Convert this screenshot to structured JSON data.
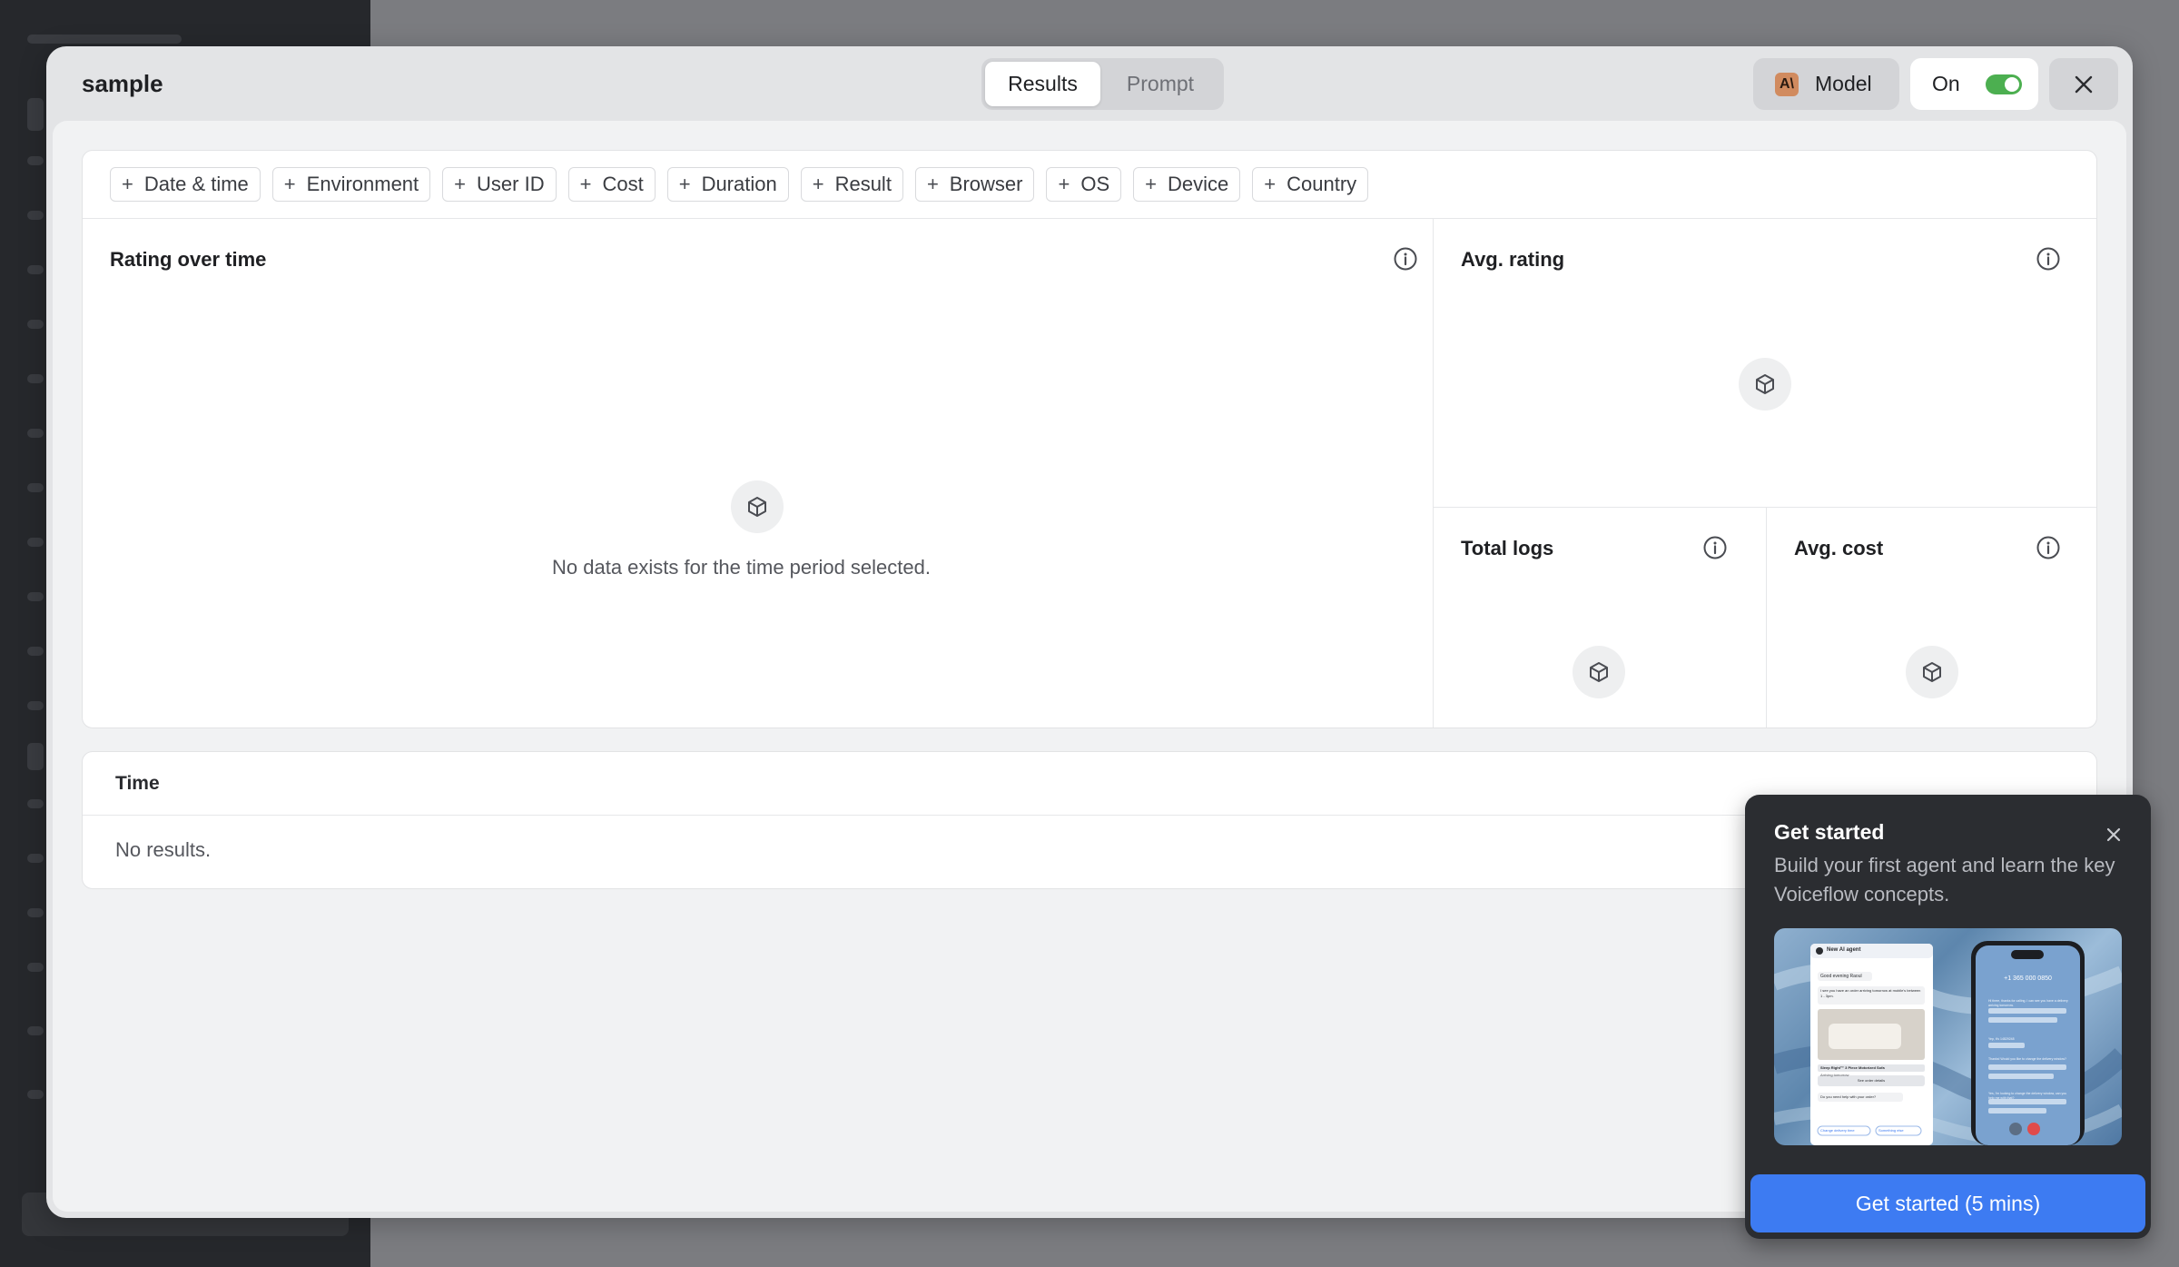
{
  "header": {
    "title": "sample",
    "tabs": [
      {
        "label": "Results",
        "active": true
      },
      {
        "label": "Prompt",
        "active": false
      }
    ],
    "model_label": "Model",
    "model_badge": "A\\",
    "on_label": "On",
    "toggle_on": true
  },
  "filters": [
    "Date & time",
    "Environment",
    "User ID",
    "Cost",
    "Duration",
    "Result",
    "Browser",
    "OS",
    "Device",
    "Country"
  ],
  "filter_plus": "+",
  "panels": {
    "rating_over_time": {
      "title": "Rating over time",
      "empty_text": "No data exists for the time period selected."
    },
    "avg_rating": {
      "title": "Avg. rating"
    },
    "total_logs": {
      "title": "Total logs"
    },
    "avg_cost": {
      "title": "Avg. cost"
    }
  },
  "table": {
    "column_header": "Time",
    "empty_text": "No results."
  },
  "get_started": {
    "title": "Get started",
    "description": "Build your first agent and learn the key Voiceflow concepts.",
    "button_label": "Get started (5 mins)",
    "preview": {
      "chat_header": "New AI agent",
      "greeting": "Good evening Raoul",
      "message": "I see you have an order arriving tomorrow at mobile's between 1 - 3pm.",
      "product": "Sleep Right™ 3 Piece Motorized Sofa",
      "arriving": "Arriving tomorrow",
      "details_button": "See order details",
      "question": "Do you need help with your order?",
      "chip_1": "Change delivery time",
      "chip_2": "Something else",
      "phone_number": "+1 365 000 0850",
      "phone_text_1": "Hi there, thanks for calling. I can see you have a delivery arriving tomorrow.",
      "phone_text_2": "Yep, it's 14829248",
      "phone_text_3": "Thanks! Would you like to change the delivery window?",
      "phone_text_4": "Yes, I'm looking to change the delivery window, can you help me with that?"
    }
  },
  "colors": {
    "accent": "#3d7bf2",
    "toggle": "#4caf50",
    "popover_bg": "#2b2d31"
  }
}
